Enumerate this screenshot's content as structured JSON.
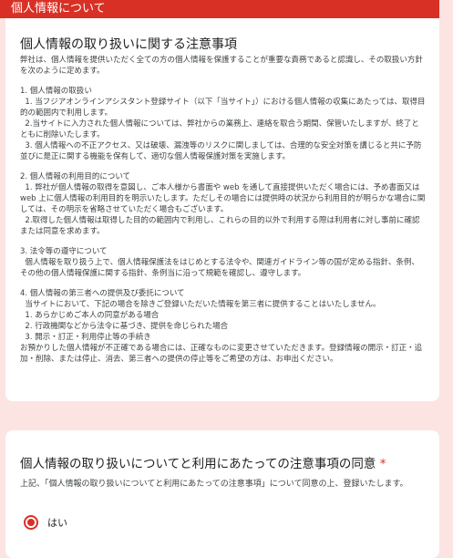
{
  "section": {
    "title": "個人情報について"
  },
  "notice": {
    "title": "個人情報の取り扱いに関する注意事項",
    "intro": "弊社は、個人情報を提供いただく全ての方の個人情報を保護することが重要な責務であると認識し、その取扱い方針を次のように定めます。",
    "s1_head": "1. 個人情報の取扱い",
    "s1_items": [
      "  1. 当フジアオンラインアシスタント登録サイト（以下「当サイト」）における個人情報の収集にあたっては、取得目的の範囲内で利用します。",
      "  2.当サイトに入力された個人情報については、弊社からの業務上、連絡を取合う期間、保管いたしますが、終了とともに削除いたします。",
      "  3. 個人情報への不正アクセス、又は破壊、漏洩等のリスクに関しましては、合理的な安全対策を講じると共に予防並びに是正に関する機能を保有して、適切な個人情報保護対策を実施します。"
    ],
    "s2_head": "2. 個人情報の利用目的について",
    "s2_items": [
      "  1. 弊社が個人情報の取得を意図し、ご本人様から書面や web を通して直接提供いただく場合には、予め書面又は web 上に個人情報の利用目的を明示いたします。ただしその場合には提供時の状況から利用目的が明らかな場合に関しては、その明示を省略させていただく場合もございます。",
      "  2.取得した個人情報は取得した目的の範囲内で利用し、これらの目的以外で利用する際は利用者に対し事前に確認または同意を求めます。"
    ],
    "s3_head": "3. 法令等の遵守について",
    "s3_body": "  個人情報を取り扱う上で、個人情報保護法をはじめとする法令や、関連ガイドライン等の国が定める指針、条例、その他の個人情報保護に関する指針、条例当に沿って規範を確認し、遵守します。",
    "s4_head": "4. 個人情報の第三者への提供及び委託について",
    "s4_body": "  当サイトにおいて、下記の場合を除きご登録いただいた情報を第三者に提供することはいたしません。",
    "s4_items": [
      "  1. あらかじめご本人の同意がある場合",
      "  2. 行政機関などから法令に基づき、提供を命じられた場合",
      "  3. 開示・訂正・利用停止等の手続き"
    ],
    "s4_tail": "お預かりした個人情報が不正確である場合には、正確なものに変更させていただきます。登録情報の開示・訂正・追加・削除、または停止、消去、第三者への提供の停止等をご希望の方は、お申出ください。"
  },
  "question": {
    "title": "個人情報の取り扱いについてと利用にあたっての注意事項の同意",
    "required_mark": "*",
    "description": "上記、「個人情報の取り扱いについてと利用にあたっての注意事項」について同意の上、登録いたします。",
    "option_label": "はい",
    "selected": true
  },
  "colors": {
    "accent": "#d93025",
    "background": "#fbe4e2"
  }
}
